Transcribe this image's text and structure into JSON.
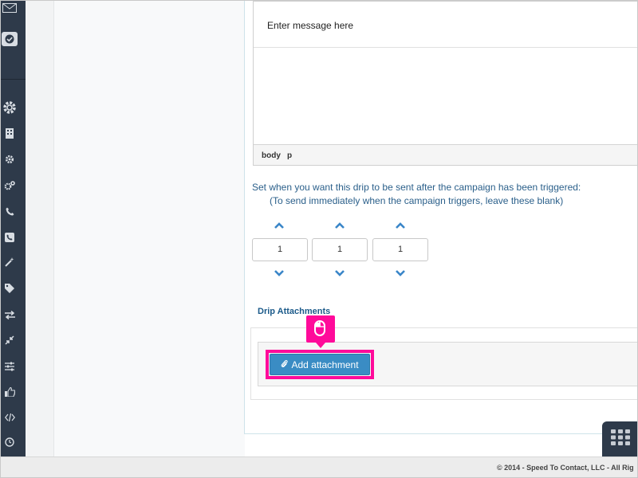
{
  "editor": {
    "message_placeholder": "Enter message here",
    "status_path": [
      "body",
      "p"
    ]
  },
  "timing": {
    "line1": "Set when you want this drip to be sent after the campaign has been triggered:",
    "line2": "(To send immediately when the campaign triggers, leave these blank)",
    "values": [
      "1",
      "1",
      "1"
    ]
  },
  "attachments": {
    "title": "Drip Attachments",
    "add_button_label": "Add attachment",
    "add_button_icon": "paperclip-icon"
  },
  "sidebar": {
    "icons": [
      "mail-icon",
      "check-icon",
      "gear-icon",
      "building-icon",
      "settings-icon",
      "cogs-icon",
      "phone-icon",
      "phone-square-icon",
      "magic-wand-icon",
      "tag-icon",
      "exchange-icon",
      "compress-icon",
      "sliders-icon",
      "thumbs-up-icon",
      "code-icon",
      "clock-icon"
    ]
  },
  "footer": {
    "text": "© 2014 - Speed To Contact, LLC - All Rig"
  },
  "colors": {
    "sidebar": "#2e3a4a",
    "accent": "#3a8cc4",
    "highlight": "#ff0a9a",
    "label_blue": "#2a5f8a"
  }
}
